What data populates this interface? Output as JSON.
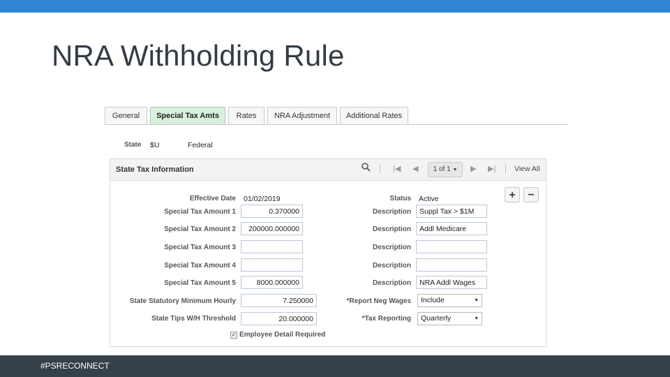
{
  "slide": {
    "title": "NRA Withholding Rule",
    "footer": "#PSRECONNECT"
  },
  "tabs": [
    {
      "label": "General"
    },
    {
      "label": "Special Tax Amts"
    },
    {
      "label": "Rates"
    },
    {
      "label": "NRA Adjustment"
    },
    {
      "label": "Additional Rates"
    }
  ],
  "state": {
    "label": "State",
    "code": "$U",
    "name": "Federal"
  },
  "panel": {
    "title": "State Tax Information",
    "pager": "1 of 1",
    "view_all": "View All"
  },
  "form": {
    "effective_date_label": "Effective Date",
    "effective_date": "01/02/2019",
    "status_label": "Status",
    "status": "Active",
    "amounts": [
      {
        "label": "Special Tax Amount 1",
        "value": "0.370000",
        "desc_label": "Description",
        "desc": "Suppl Tax > $1M"
      },
      {
        "label": "Special Tax Amount 2",
        "value": "200000.000000",
        "desc_label": "Description",
        "desc": "Addl Medicare"
      },
      {
        "label": "Special Tax Amount 3",
        "value": "",
        "desc_label": "Description",
        "desc": ""
      },
      {
        "label": "Special Tax Amount 4",
        "value": "",
        "desc_label": "Description",
        "desc": ""
      },
      {
        "label": "Special Tax Amount 5",
        "value": "8000.000000",
        "desc_label": "Description",
        "desc": "NRA Addl Wages"
      }
    ],
    "min_hourly_label": "State Statutory Minimum Hourly",
    "min_hourly": "7.250000",
    "tips_label": "State Tips W/H Threshold",
    "tips": "20.000000",
    "report_neg_label": "*Report Neg Wages",
    "report_neg": "Include",
    "tax_reporting_label": "*Tax Reporting",
    "tax_reporting": "Quarterly",
    "employee_detail_label": "Employee Detail Required",
    "employee_detail_checked": true
  }
}
